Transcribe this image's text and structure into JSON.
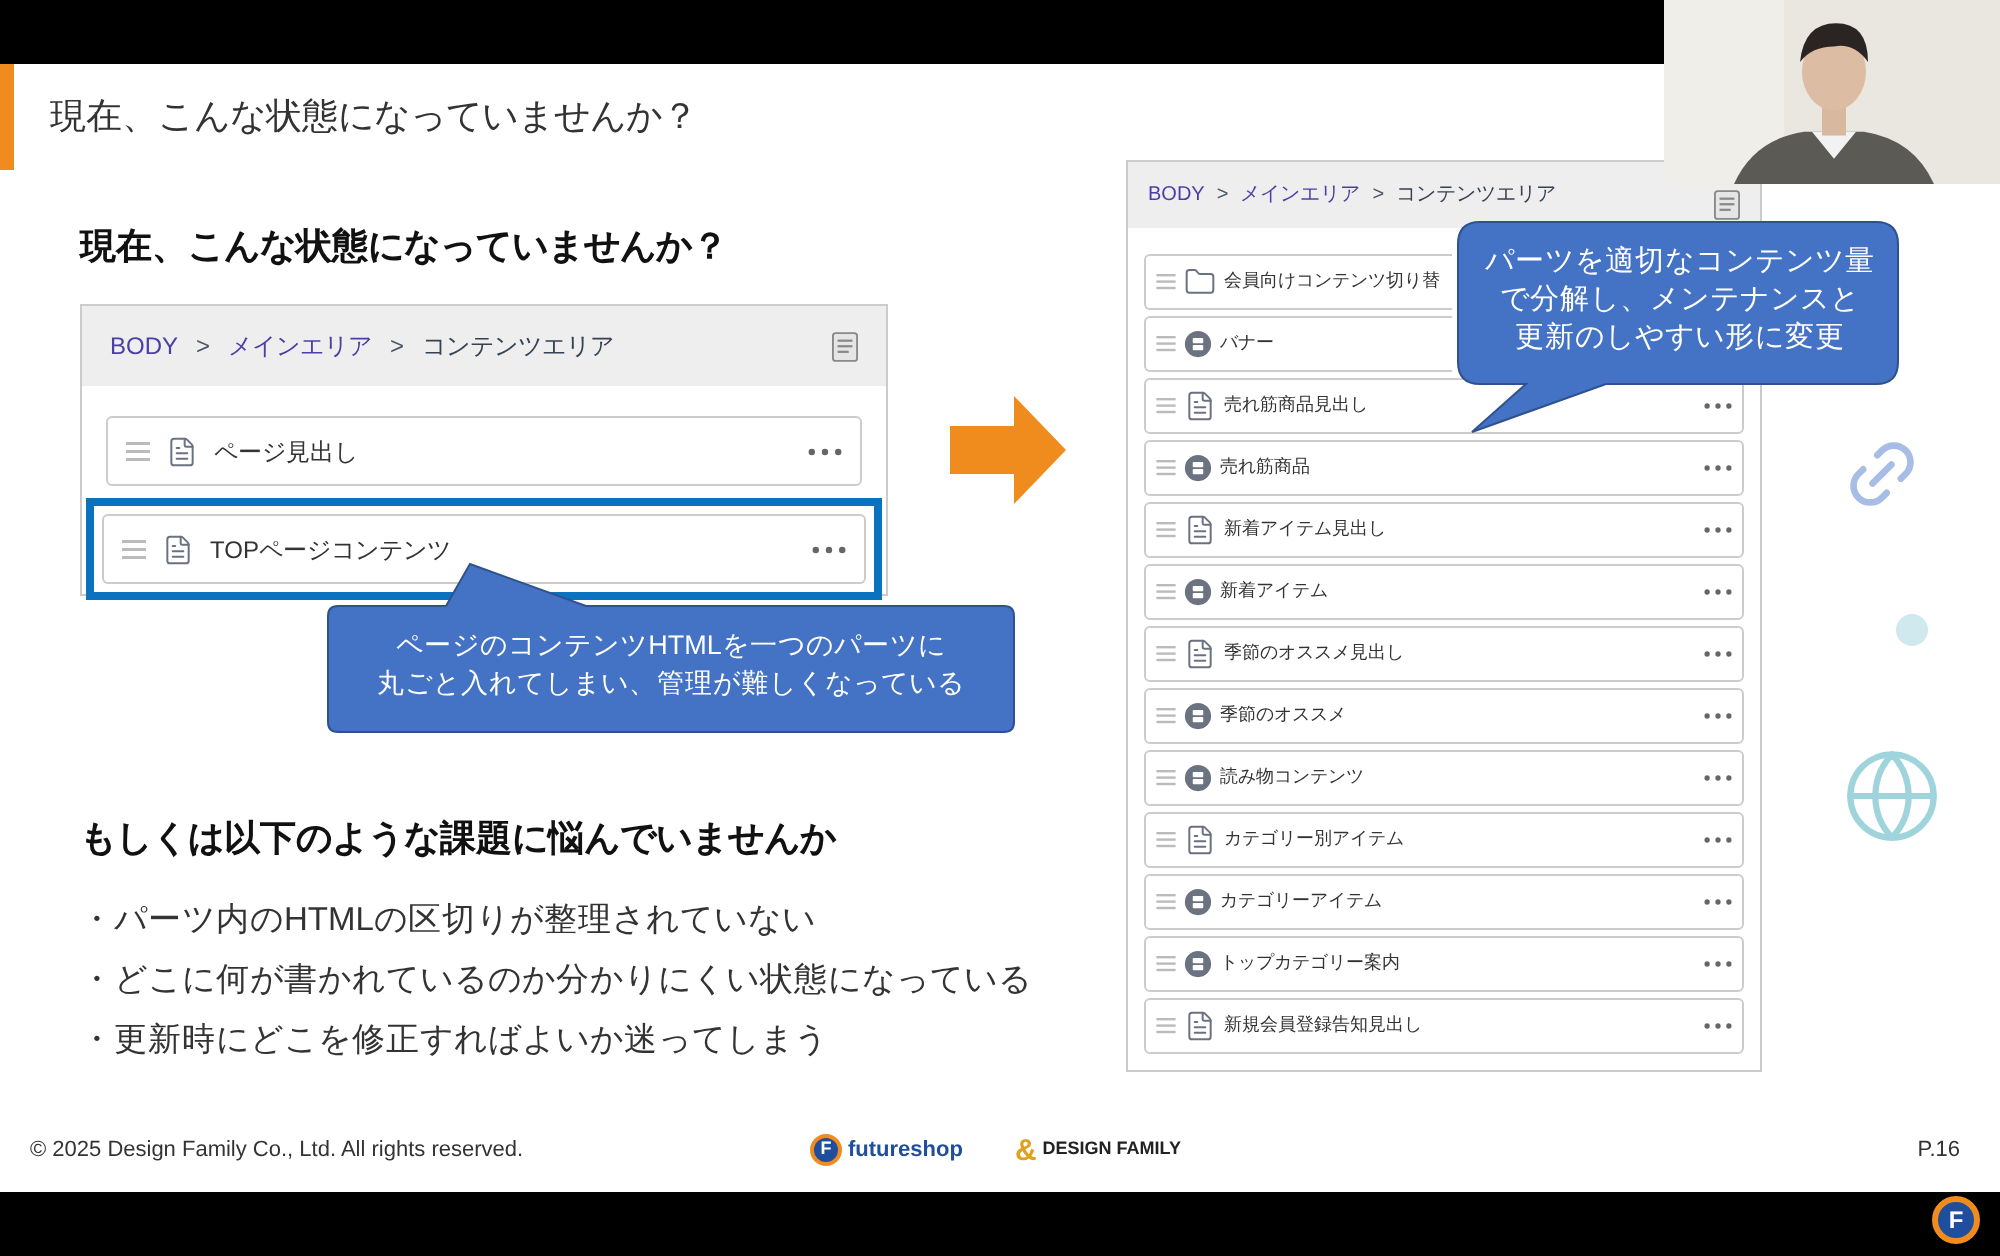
{
  "slide": {
    "title": "現在、こんな状態になっていませんか？",
    "heading": "現在、こんな状態になっていませんか？",
    "left_panel": {
      "breadcrumb": [
        {
          "label": "BODY",
          "link": true
        },
        {
          "label": "メインエリア",
          "link": true
        },
        {
          "label": "コンテンツエリア",
          "link": false
        }
      ],
      "separator": ">",
      "rows": [
        {
          "label": "ページ見出し",
          "kind": "page",
          "highlighted": false
        },
        {
          "label": "TOPページコンテンツ",
          "kind": "page",
          "highlighted": true
        }
      ],
      "callout": [
        "ページのコンテンツHTMLを一つのパーツに",
        "丸ごと入れてしまい、管理が難しくなっている"
      ]
    },
    "subheading": "もしくは以下のような課題に悩んでいませんか",
    "bullets": [
      "・パーツ内のHTMLの区切りが整理されていない",
      "・どこに何が書かれているのか分かりにくい状態になっている",
      "・更新時にどこを修正すればよいか迷ってしまう"
    ],
    "right_panel": {
      "breadcrumb": [
        {
          "label": "BODY",
          "link": true
        },
        {
          "label": "メインエリア",
          "link": true
        },
        {
          "label": "コンテンツエリア",
          "link": false
        }
      ],
      "separator": ">",
      "rows": [
        {
          "label": "会員向けコンテンツ切り替",
          "kind": "folder",
          "more_button": false
        },
        {
          "label": "バナー",
          "kind": "module",
          "more_button": false
        },
        {
          "label": "売れ筋商品見出し",
          "kind": "page",
          "more_button": true
        },
        {
          "label": "売れ筋商品",
          "kind": "module",
          "more_button": true
        },
        {
          "label": "新着アイテム見出し",
          "kind": "page",
          "more_button": true
        },
        {
          "label": "新着アイテム",
          "kind": "module",
          "more_button": true
        },
        {
          "label": "季節のオススメ見出し",
          "kind": "page",
          "more_button": true
        },
        {
          "label": "季節のオススメ",
          "kind": "module",
          "more_button": true
        },
        {
          "label": "読み物コンテンツ",
          "kind": "module",
          "more_button": true
        },
        {
          "label": "カテゴリー別アイテム",
          "kind": "page",
          "more_button": true
        },
        {
          "label": "カテゴリーアイテム",
          "kind": "module",
          "more_button": true
        },
        {
          "label": "トップカテゴリー案内",
          "kind": "module",
          "more_button": true
        },
        {
          "label": "新規会員登録告知見出し",
          "kind": "page",
          "more_button": true
        }
      ],
      "callout": [
        "パーツを適切なコンテンツ量",
        "で分解し、メンテナンスと",
        "更新のしやすい形に変更"
      ]
    },
    "footer": {
      "copyright": "© 2025 Design Family Co., Ltd. All rights reserved.",
      "logos": [
        {
          "mark": "F",
          "name": "futureshop"
        },
        {
          "mark": "&",
          "name": "DESIGN FAMILY"
        }
      ],
      "page": "P.16"
    }
  },
  "corner_badge": "F"
}
